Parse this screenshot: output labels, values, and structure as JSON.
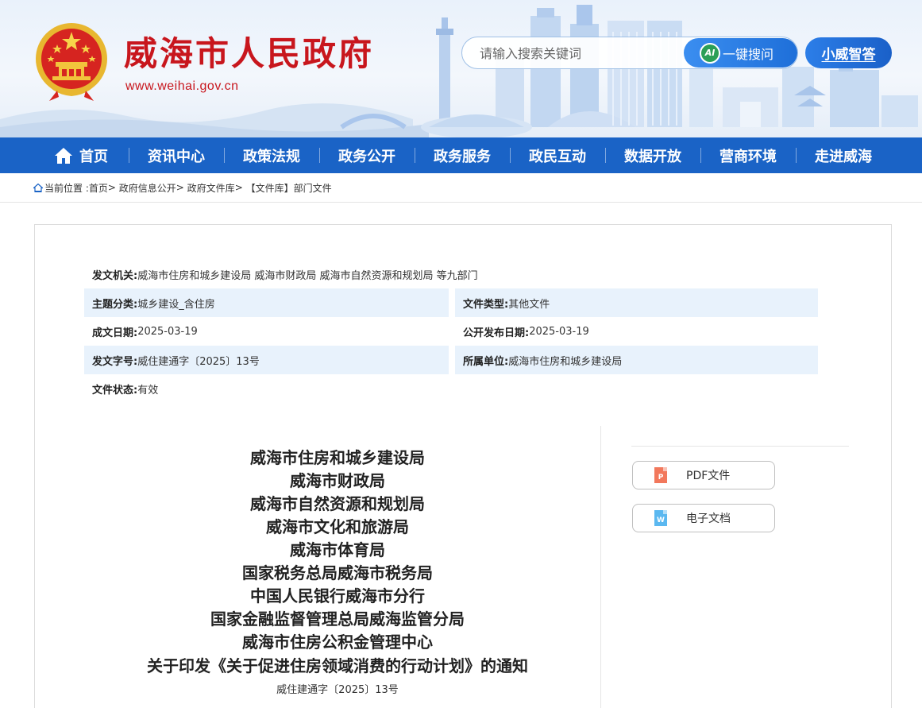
{
  "header": {
    "site_title": "威海市人民政府",
    "site_url": "www.weihai.gov.cn",
    "emblem_icon": "national-emblem-icon",
    "search": {
      "placeholder": "请输入搜索关键词",
      "button_label": "一键搜问",
      "ai_badge": "AI"
    },
    "assistant_label": "小威智答"
  },
  "nav": {
    "items": [
      "首页",
      "资讯中心",
      "政策法规",
      "政务公开",
      "政务服务",
      "政民互动",
      "数据开放",
      "营商环境",
      "走进威海"
    ],
    "home_icon": "home-icon"
  },
  "breadcrumb": {
    "prefix": "当前位置 :",
    "items": [
      "首页",
      "政府信息公开",
      "政府文件库",
      "【文件库】部门文件"
    ],
    "separator": ">"
  },
  "meta": {
    "issuer": {
      "key": "发文机关:",
      "value": "威海市住房和城乡建设局 威海市财政局 威海市自然资源和规划局 等九部门"
    },
    "subject": {
      "key": "主题分类:",
      "value": "城乡建设_含住房"
    },
    "file_type": {
      "key": "文件类型:",
      "value": "其他文件"
    },
    "created": {
      "key": "成文日期:",
      "value": "2025-03-19"
    },
    "published": {
      "key": "公开发布日期:",
      "value": "2025-03-19"
    },
    "doc_no": {
      "key": "发文字号:",
      "value": "威住建通字〔2025〕13号"
    },
    "unit": {
      "key": "所属单位:",
      "value": "威海市住房和城乡建设局"
    },
    "status": {
      "key": "文件状态:",
      "value": "有效"
    }
  },
  "document": {
    "issuers": [
      "威海市住房和城乡建设局",
      "威海市财政局",
      "威海市自然资源和规划局",
      "威海市文化和旅游局",
      "威海市体育局",
      "国家税务总局威海市税务局",
      "中国人民银行威海市分行",
      "国家金融监督管理总局威海监管分局",
      "威海市住房公积金管理中心"
    ],
    "title": "关于印发《关于促进住房领域消费的行动计划》的通知",
    "number": "威住建通字〔2025〕13号"
  },
  "downloads": {
    "pdf": {
      "label": "PDF文件",
      "icon_letter": "P",
      "color": "#f2785c"
    },
    "word": {
      "label": "电子文档",
      "icon_letter": "W",
      "color": "#5bb8f0"
    }
  },
  "colors": {
    "brand_red": "#c8161d",
    "nav_blue": "#1a63c6",
    "row_shade": "#e8f2fc"
  }
}
